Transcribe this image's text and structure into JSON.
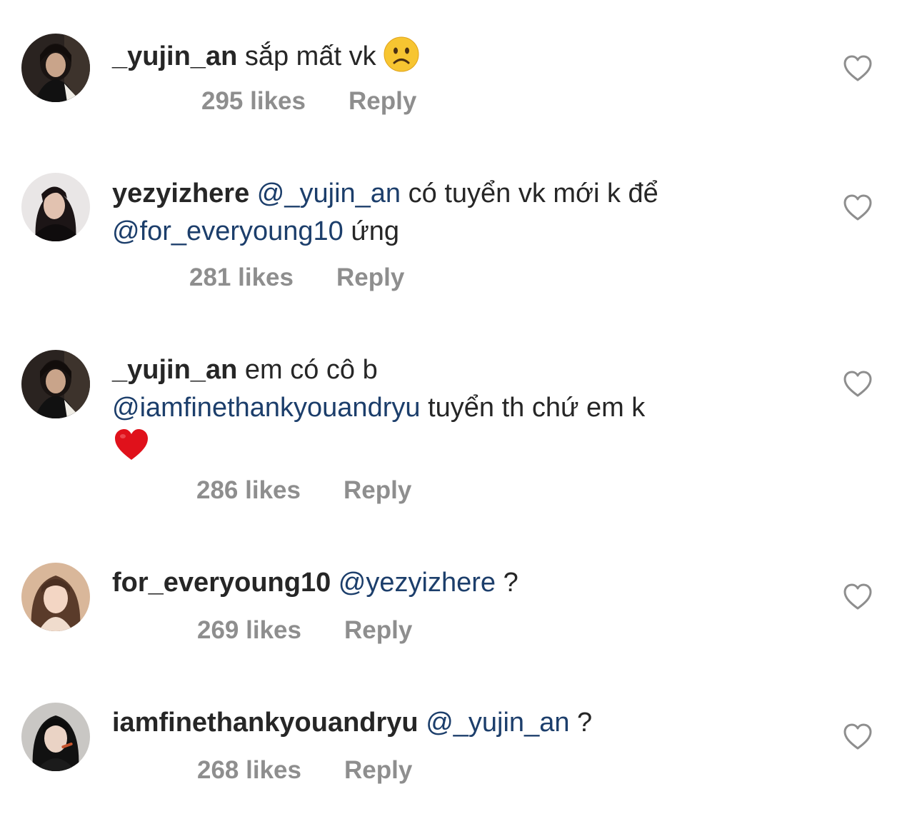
{
  "comments": [
    {
      "username": "_yujin_an",
      "text": "sắp mất vk",
      "emoji": "frowning-face",
      "likes": "295 likes",
      "reply": "Reply"
    },
    {
      "username": "yezyizhere",
      "mention1": "@_yujin_an",
      "text1": "có tuyển vk mới k để",
      "mention2": "@for_everyoung10",
      "text2": "ứng",
      "likes": "281 likes",
      "reply": "Reply"
    },
    {
      "username": "_yujin_an",
      "text1": "em có cô b",
      "mention1": "@iamfinethankyouandryu",
      "text2": "tuyển th chứ em k",
      "emoji": "red-heart",
      "likes": "286 likes",
      "reply": "Reply"
    },
    {
      "username": "for_everyoung10",
      "mention1": "@yezyizhere",
      "text1": "?",
      "likes": "269 likes",
      "reply": "Reply"
    },
    {
      "username": "iamfinethankyouandryu",
      "mention1": "@_yujin_an",
      "text1": "?",
      "likes": "268 likes",
      "reply": "Reply"
    }
  ],
  "colors": {
    "text": "#262626",
    "mention": "#1c3e6b",
    "meta": "#8e8e8e",
    "heart_outline": "#8e8e8e",
    "emoji_heart": "#e0111b",
    "emoji_face": "#f7c531"
  },
  "icons": {
    "like": "heart-outline-icon",
    "avatar": "profile-photo"
  }
}
